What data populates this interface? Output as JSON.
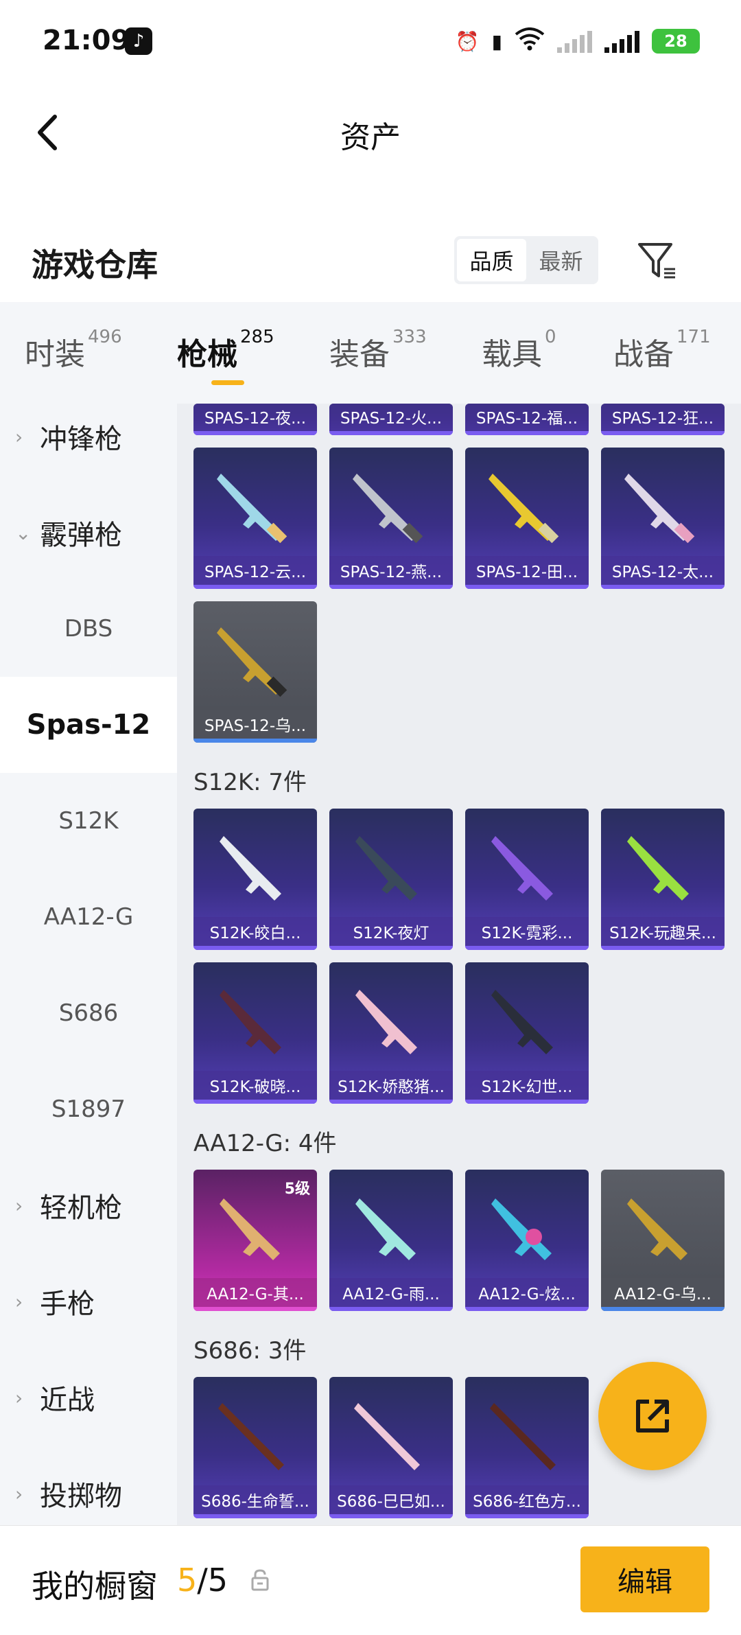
{
  "status_bar": {
    "time": "21:09",
    "battery": "28",
    "network": "5G"
  },
  "header": {
    "title": "资产"
  },
  "section": {
    "title": "游戏仓库",
    "sort_options": [
      "品质",
      "最新"
    ],
    "sort_selected": "品质"
  },
  "tabs": [
    {
      "label": "时装",
      "count": "496"
    },
    {
      "label": "枪械",
      "count": "285",
      "active": true
    },
    {
      "label": "装备",
      "count": "333"
    },
    {
      "label": "载具",
      "count": "0"
    },
    {
      "label": "战备",
      "count": "171"
    }
  ],
  "sidebar": {
    "items": [
      {
        "label": "冲锋枪",
        "type": "category"
      },
      {
        "label": "霰弹枪",
        "type": "category",
        "expanded": true
      },
      {
        "label": "DBS",
        "type": "sub"
      },
      {
        "label": "Spas-12",
        "type": "sub",
        "selected": true
      },
      {
        "label": "S12K",
        "type": "sub"
      },
      {
        "label": "AA12-G",
        "type": "sub"
      },
      {
        "label": "S686",
        "type": "sub"
      },
      {
        "label": "S1897",
        "type": "sub"
      },
      {
        "label": "轻机枪",
        "type": "category"
      },
      {
        "label": "手枪",
        "type": "category"
      },
      {
        "label": "近战",
        "type": "category"
      },
      {
        "label": "投掷物",
        "type": "category"
      }
    ]
  },
  "content": {
    "spas_top_row": [
      "SPAS-12-夜...",
      "SPAS-12-火...",
      "SPAS-12-福...",
      "SPAS-12-狂..."
    ],
    "spas_rows": [
      [
        "SPAS-12-云...",
        "SPAS-12-燕...",
        "SPAS-12-田...",
        "SPAS-12-太..."
      ],
      [
        "SPAS-12-乌..."
      ]
    ],
    "groups": [
      {
        "title": "S12K: 7件",
        "items": [
          "S12K-皎白...",
          "S12K-夜灯",
          "S12K-霓彩...",
          "S12K-玩趣呆...",
          "S12K-破晓...",
          "S12K-娇憨猪...",
          "S12K-幻世..."
        ]
      },
      {
        "title": "AA12-G: 4件",
        "items": [
          "AA12-G-其...",
          "AA12-G-雨...",
          "AA12-G-炫...",
          "AA12-G-乌..."
        ],
        "first_level": "5级"
      },
      {
        "title": "S686: 3件",
        "items": [
          "S686-生命誓...",
          "S686-巳巳如...",
          "S686-红色方..."
        ]
      }
    ]
  },
  "bottom_bar": {
    "label": "我的橱窗",
    "current": "5",
    "total": "/5",
    "edit_label": "编辑"
  },
  "colors": {
    "accent": "#f7b21a",
    "card_purple": "#3a2f86",
    "card_gray": "#55585f",
    "card_pink": "#b02aa0"
  }
}
